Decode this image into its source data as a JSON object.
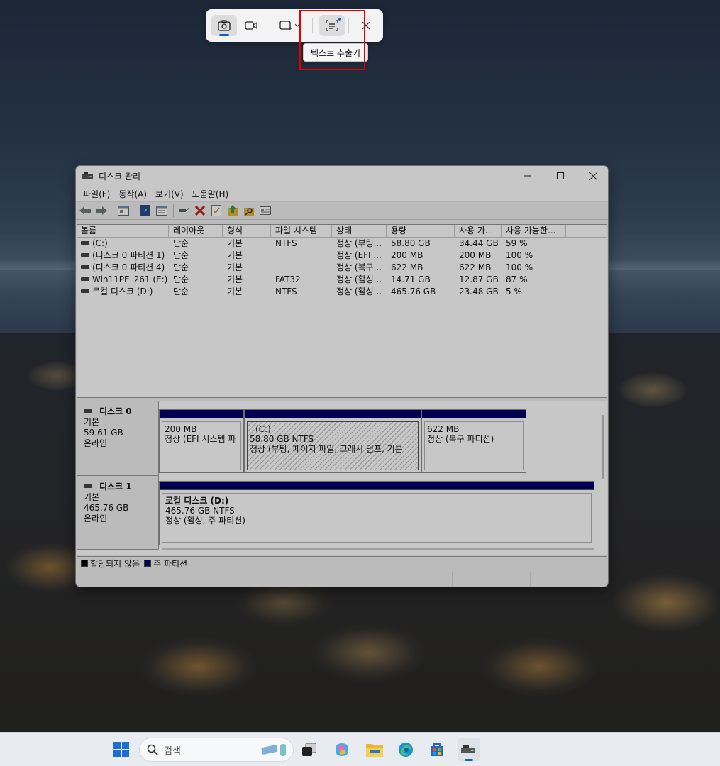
{
  "snipping_toolbar": {
    "tooltip": "텍스트 추출기"
  },
  "window": {
    "title": "디스크 관리",
    "menu": [
      "파일(F)",
      "동작(A)",
      "보기(V)",
      "도움말(H)"
    ]
  },
  "volume_list": {
    "columns": [
      "볼륨",
      "레이아웃",
      "형식",
      "파일 시스템",
      "상태",
      "용량",
      "사용 가...",
      "사용 가능한..."
    ],
    "rows": [
      [
        "(C:)",
        "단순",
        "기본",
        "NTFS",
        "정상 (부팅...",
        "58.80 GB",
        "34.44 GB",
        "59 %"
      ],
      [
        "(디스크 0 파티션 1)",
        "단순",
        "기본",
        "",
        "정상 (EFI ...",
        "200 MB",
        "200 MB",
        "100 %"
      ],
      [
        "(디스크 0 파티션 4)",
        "단순",
        "기본",
        "",
        "정상 (복구...",
        "622 MB",
        "622 MB",
        "100 %"
      ],
      [
        "Win11PE_261 (E:)",
        "단순",
        "기본",
        "FAT32",
        "정상 (활성...",
        "14.71 GB",
        "12.87 GB",
        "87 %"
      ],
      [
        "로컬 디스크 (D:)",
        "단순",
        "기본",
        "NTFS",
        "정상 (활성...",
        "465.76 GB",
        "23.48 GB",
        "5 %"
      ]
    ]
  },
  "disks": [
    {
      "name": "디스크 0",
      "type": "기본",
      "size": "59.61 GB",
      "status": "온라인",
      "partitions": [
        {
          "line1": "",
          "line2": "200 MB",
          "line3": "정상 (EFI 시스템 파"
        },
        {
          "line1": "(C:)",
          "line2": "58.80 GB NTFS",
          "line3": "정상 (부팅, 페이지 파일, 크래시 덤프, 기본"
        },
        {
          "line1": "",
          "line2": "622 MB",
          "line3": "정상 (복구 파티션)"
        }
      ]
    },
    {
      "name": "디스크 1",
      "type": "기본",
      "size": "465.76 GB",
      "status": "온라인",
      "partitions": [
        {
          "line1": "로컬 디스크  (D:)",
          "line2": "465.76 GB NTFS",
          "line3": "정상 (활성, 주 파티션)"
        }
      ]
    }
  ],
  "legend": {
    "unallocated": "할당되지 않음",
    "primary": "주 파티션",
    "unallocated_color": "#000000",
    "primary_color": "#00006b"
  },
  "taskbar": {
    "search_placeholder": "검색",
    "icons": [
      "windows-start-icon",
      "search-icon",
      "task-view-icon",
      "copilot-icon",
      "file-explorer-icon",
      "edge-icon",
      "store-icon",
      "disk-management-icon"
    ]
  }
}
